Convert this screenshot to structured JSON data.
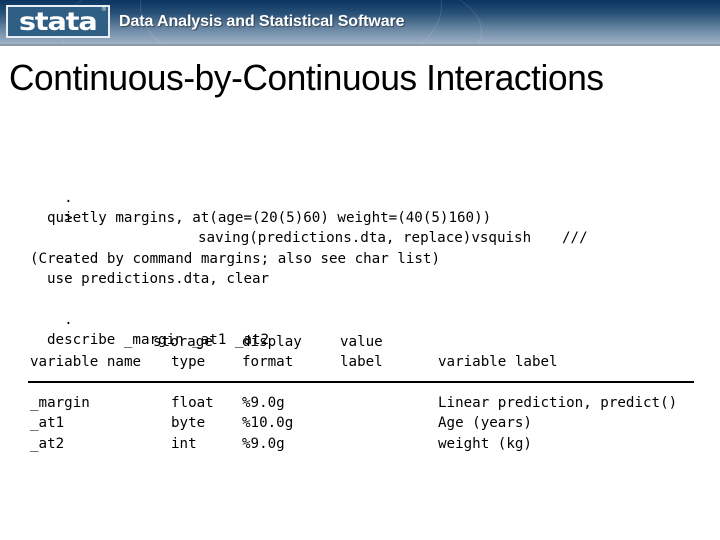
{
  "banner": {
    "logo_text": "stata",
    "logo_reg": "®",
    "tagline": "Data Analysis and Statistical Software",
    "colors": {
      "gradient_top": "#0a3560",
      "gradient_bottom": "#a7b8cb",
      "logo_box": "#2f5f85"
    }
  },
  "slide": {
    "title": "Continuous-by-Continuous Interactions"
  },
  "console": {
    "commands": [
      {
        "prompt": ".",
        "text": "quietly margins, at(age=(20(5)60) weight=(40(5)160))",
        "continuation_marker": "///"
      },
      {
        "prompt": ">",
        "text": "saving(predictions.dta, replace)vsquish"
      },
      {
        "prompt": ".",
        "text": "use predictions.dta, clear"
      },
      {
        "prompt": "",
        "text": "(Created by command margins; also see char list)"
      },
      {
        "prompt": ".",
        "text": "describe _margin _at1 _at2"
      }
    ],
    "describe_table": {
      "header_row1": {
        "storage": "storage",
        "display": "display",
        "value": "value"
      },
      "header_row2": {
        "variable_name": "variable name",
        "type": "type",
        "format": "format",
        "label": "label",
        "variable_label": "variable label"
      },
      "rows": [
        {
          "name": "_margin",
          "type": "float",
          "format": "%9.0g",
          "value_label": "",
          "variable_label": "Linear prediction, predict()"
        },
        {
          "name": "_at1",
          "type": "byte",
          "format": "%10.0g",
          "value_label": "",
          "variable_label": "Age (years)"
        },
        {
          "name": "_at2",
          "type": "int",
          "format": "%9.0g",
          "value_label": "",
          "variable_label": "weight (kg)"
        }
      ]
    }
  }
}
